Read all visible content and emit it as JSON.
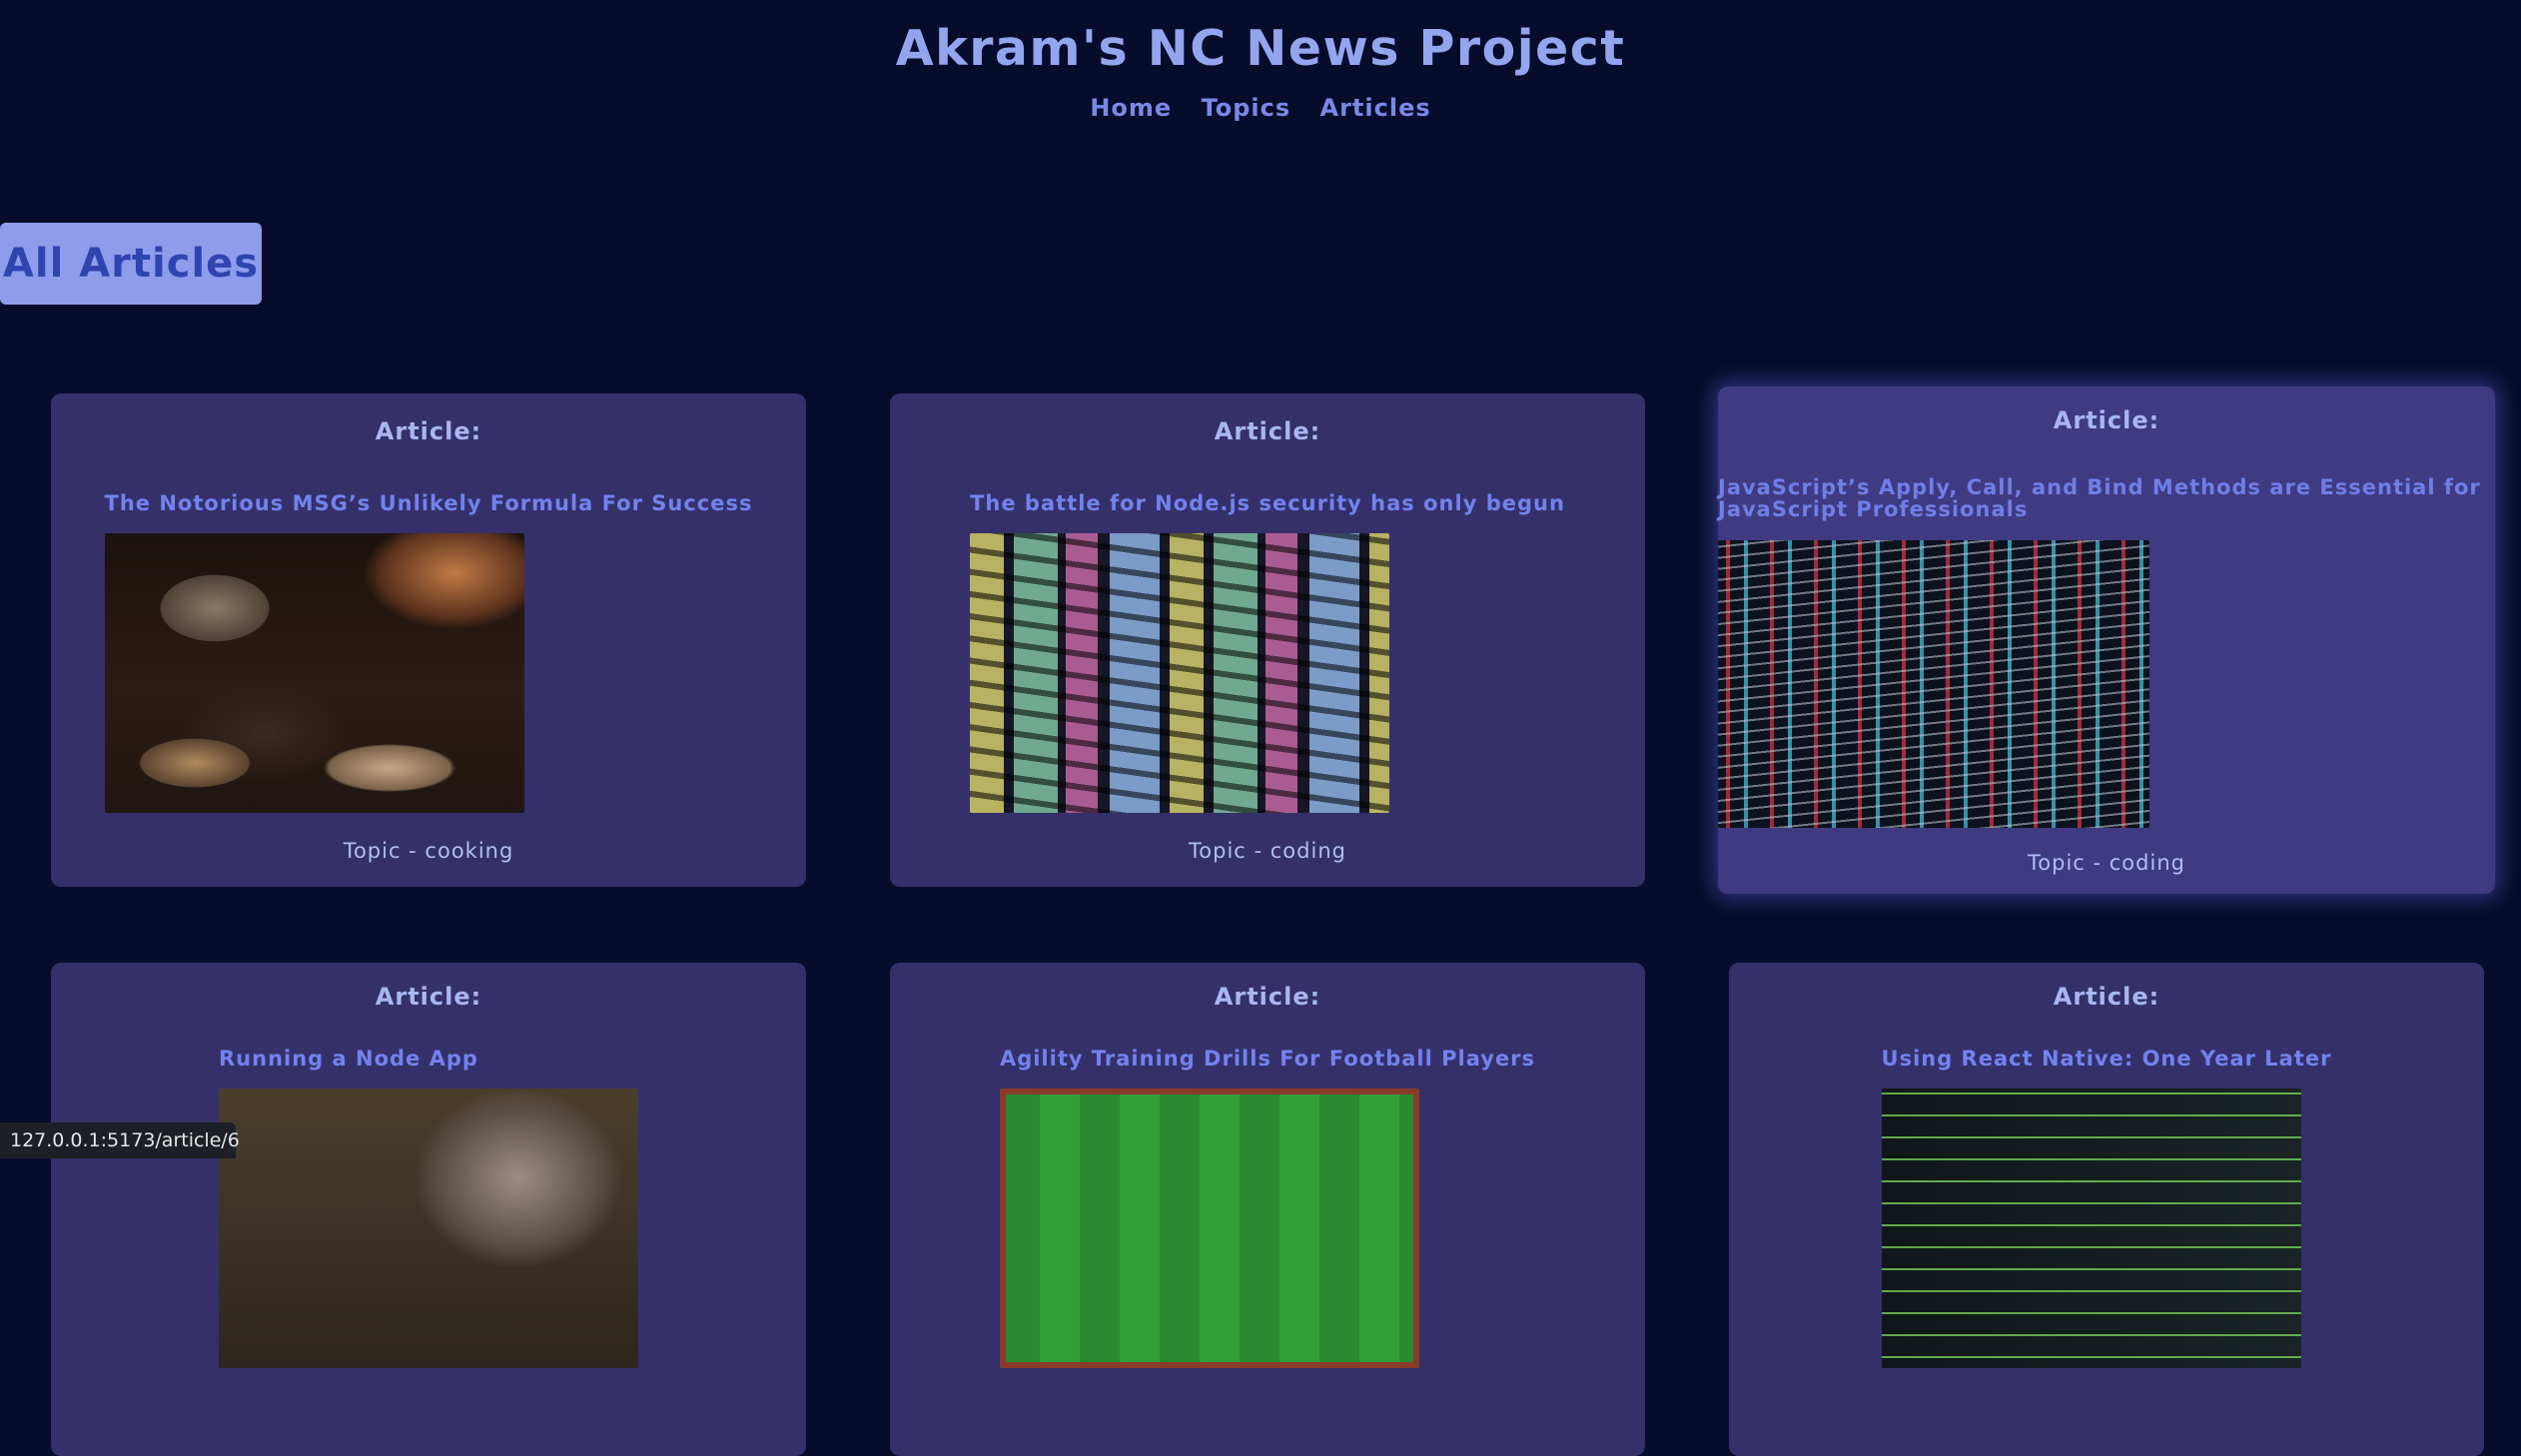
{
  "site": {
    "title": "Akram's NC News Project",
    "nav": [
      "Home",
      "Topics",
      "Articles"
    ]
  },
  "page": {
    "heading": "All Articles"
  },
  "articles": [
    {
      "label": "Article:",
      "title": "The Notorious MSG’s Unlikely Formula For Success",
      "topic": "Topic - cooking",
      "image": "cooking-photo"
    },
    {
      "label": "Article:",
      "title": "The battle for Node.js security has only begun",
      "topic": "Topic - coding",
      "image": "code-screen-photo"
    },
    {
      "label": "Article:",
      "title": "JavaScript’s Apply, Call, and Bind Methods are Essential for JavaScript Professionals",
      "topic": "Topic - coding",
      "image": "code-monitor-photo"
    },
    {
      "label": "Article:",
      "title": "Running a Node App",
      "image": "person-photo"
    },
    {
      "label": "Article:",
      "title": "Agility Training Drills For Football Players",
      "image": "football-pitch-photo"
    },
    {
      "label": "Article:",
      "title": "Using React Native: One Year Later",
      "image": "terminal-code-photo"
    }
  ],
  "status_bar": {
    "url": "127.0.0.1:5173/article/6"
  },
  "colors": {
    "background": "#070c2b",
    "card": "#35306a",
    "title": "#94a5f0",
    "link": "#7282f0",
    "heading_bg": "#8f9ceb"
  }
}
